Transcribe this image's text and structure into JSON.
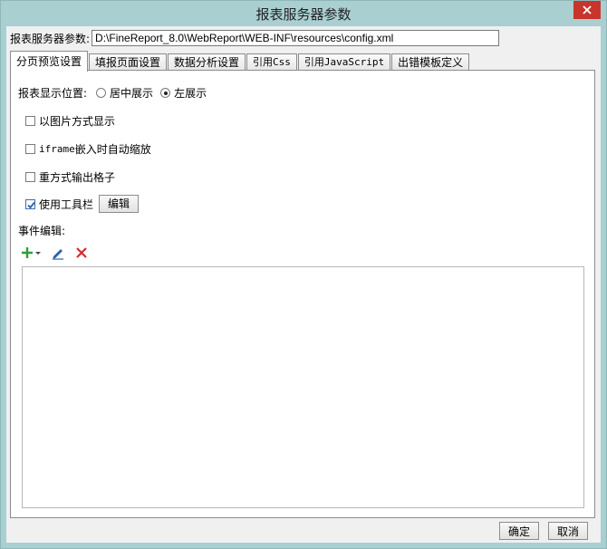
{
  "window": {
    "title": "报表服务器参数"
  },
  "param": {
    "label": "报表服务器参数:",
    "value": "D:\\FineReport_8.0\\WebReport\\WEB-INF\\resources\\config.xml"
  },
  "tabs": [
    {
      "label": "分页预览设置",
      "active": true
    },
    {
      "label": "填报页面设置",
      "active": false
    },
    {
      "label": "数据分析设置",
      "active": false
    },
    {
      "label": "引用Css",
      "active": false
    },
    {
      "label": "引用JavaScript",
      "active": false
    },
    {
      "label": "出错模板定义",
      "active": false
    }
  ],
  "position": {
    "label": "报表显示位置:",
    "options": [
      {
        "label": "居中展示",
        "selected": false
      },
      {
        "label": "左展示",
        "selected": true
      }
    ]
  },
  "options": {
    "image_mode": {
      "label": "以图片方式显示",
      "checked": false
    },
    "iframe_zoom": {
      "label_prefix": "iframe",
      "label_suffix": "嵌入时自动缩放",
      "checked": false
    },
    "redraw_cells": {
      "label": "重方式输出格子",
      "checked": false
    },
    "toolbar": {
      "label": "使用工具栏",
      "checked": true,
      "edit_label": "编辑"
    }
  },
  "events": {
    "label": "事件编辑:",
    "icons": [
      "add-icon",
      "edit-icon",
      "delete-icon"
    ],
    "items": []
  },
  "footer": {
    "ok_label": "确定",
    "cancel_label": "取消"
  },
  "colors": {
    "titlebar": "#a9cfd1",
    "close": "#c7352c",
    "add": "#2e9e3a",
    "edit": "#2b5fae",
    "delete": "#d62b2b"
  }
}
